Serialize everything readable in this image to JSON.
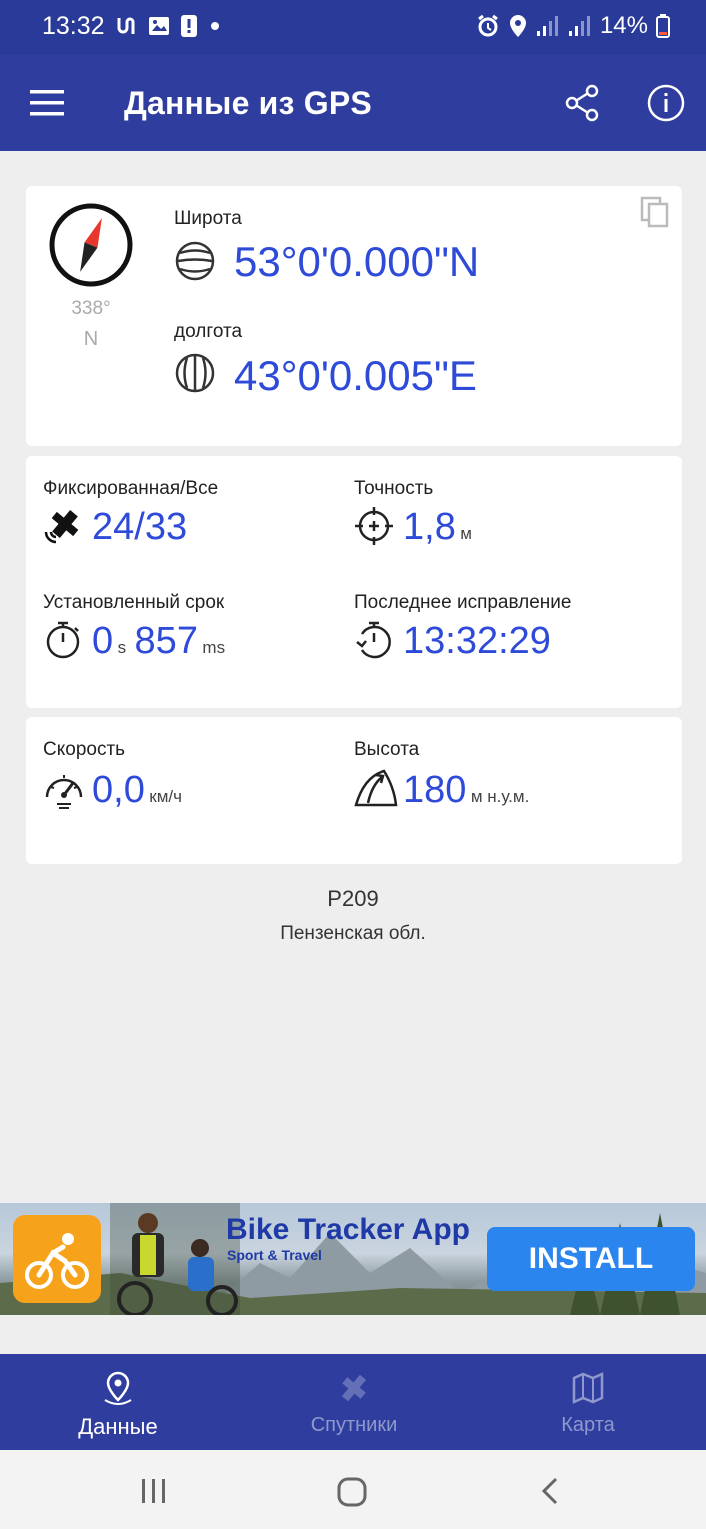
{
  "status_bar": {
    "time": "13:32",
    "battery": "14%"
  },
  "app_bar": {
    "title": "Данные из GPS"
  },
  "coords": {
    "heading_degrees": "338°",
    "heading_direction": "N",
    "latitude_label": "Широта",
    "latitude_value": "53°0'0.000\"N",
    "longitude_label": "долгота",
    "longitude_value": "43°0'0.005\"E"
  },
  "fix": {
    "satellites_label": "Фиксированная/Все",
    "satellites_value": "24/33",
    "accuracy_label": "Точность",
    "accuracy_value": "1,8",
    "accuracy_unit": "м",
    "ttf_label": "Установленный срок",
    "ttf_seconds": "0",
    "ttf_seconds_unit": "s",
    "ttf_ms": "857",
    "ttf_ms_unit": "ms",
    "last_fix_label": "Последнее исправление",
    "last_fix_value": "13:32:29"
  },
  "motion": {
    "speed_label": "Скорость",
    "speed_value": "0,0",
    "speed_unit": "км/ч",
    "altitude_label": "Высота",
    "altitude_value": "180",
    "altitude_unit": "м н.у.м."
  },
  "location": {
    "road": "Р209",
    "region": "Пензенская обл."
  },
  "ad": {
    "title": "Bike Tracker App",
    "subtitle": "Sport & Travel",
    "button": "INSTALL"
  },
  "bottom_nav": {
    "items": [
      {
        "label": "Данные",
        "icon": "location-pin-icon",
        "active": true
      },
      {
        "label": "Спутники",
        "icon": "satellite-icon",
        "active": false
      },
      {
        "label": "Карта",
        "icon": "map-icon",
        "active": false
      }
    ]
  },
  "colors": {
    "primary": "#2f3e9e",
    "value_blue": "#2e4ad8",
    "ad_button": "#2a85ee",
    "ad_icon": "#f7a21b"
  }
}
